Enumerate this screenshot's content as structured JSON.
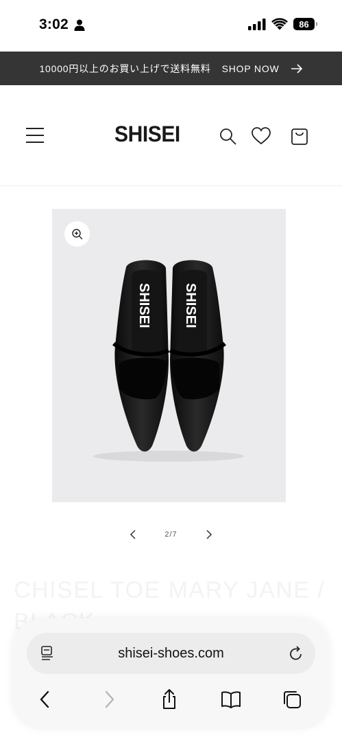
{
  "status_bar": {
    "time": "3:02",
    "battery": "86"
  },
  "announcement": {
    "text": "10000円以上のお買い上げで送料無料",
    "link_label": "SHOP NOW"
  },
  "header": {
    "logo": "SHISEI"
  },
  "gallery": {
    "shoe_brand_print": "SHISEI",
    "counter": "2/7"
  },
  "product": {
    "title": "CHISEL TOE MARY JANE / BLACK"
  },
  "browser": {
    "url": "shisei-shoes.com"
  },
  "colors": {
    "announcement_bg": "#353535",
    "gallery_bg": "#ebebed",
    "browser_bar_bg": "#f7f7f7"
  }
}
